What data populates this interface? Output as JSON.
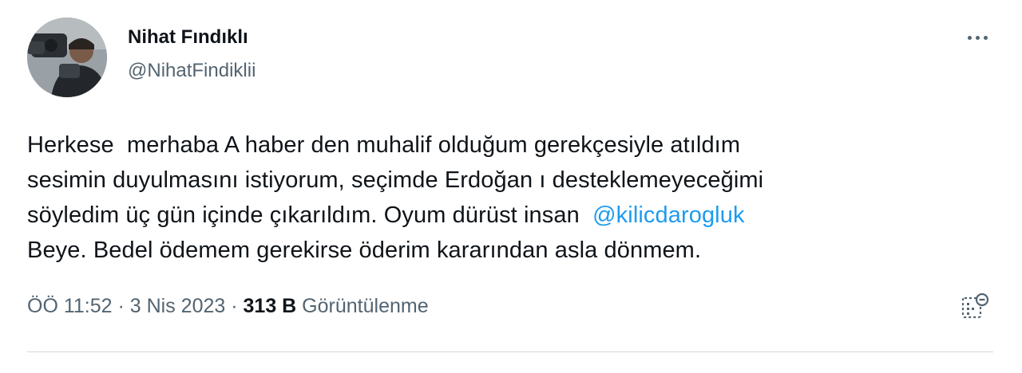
{
  "author": {
    "display_name": "Nihat Fındıklı",
    "handle": "@NihatFindiklii"
  },
  "more_icon": "more-horizontal-icon",
  "tweet": {
    "text_part1": "Herkese  merhaba A haber den muhalif olduğum gerekçesiyle atıldım\nsesimin duyulmasını istiyorum, seçimde Erdoğan ı desteklemeyeceğimi\nsöyledim üç gün içinde çıkarıldım. Oyum dürüst insan  ",
    "mention": "@kilicdarogluk",
    "text_part2": "\nBeye. Bedel ödemem gerekirse öderim kararından asla dönmem."
  },
  "meta": {
    "time": "ÖÖ 11:52",
    "separator": " · ",
    "date": "3 Nis 2023",
    "views_count": "313 B",
    "views_label": " Görüntülenme"
  },
  "analytics_icon": "analytics-icon",
  "colors": {
    "text": "#0f1419",
    "secondary": "#536471",
    "link": "#1d9bf0",
    "divider": "#cfd9de"
  }
}
